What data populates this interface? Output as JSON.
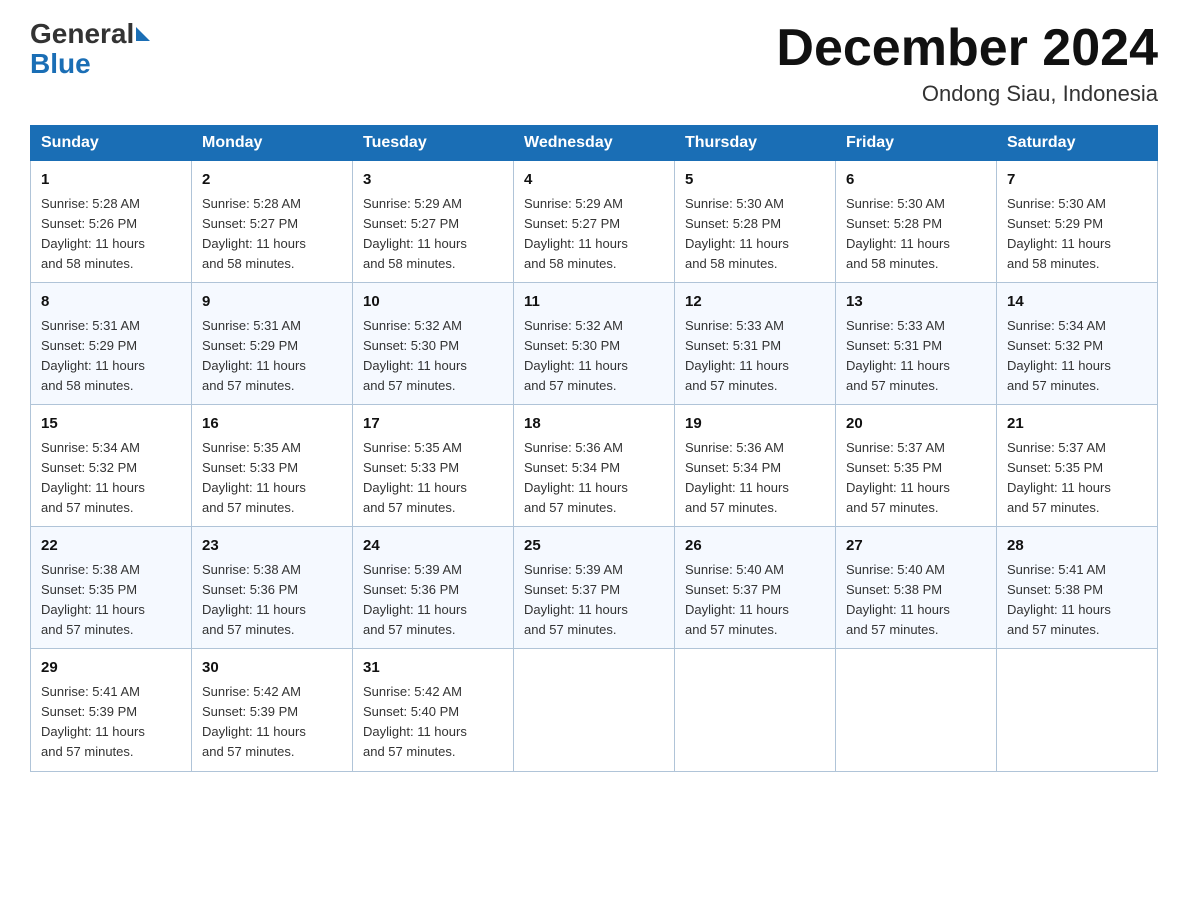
{
  "logo": {
    "general": "General",
    "blue": "Blue"
  },
  "title": "December 2024",
  "location": "Ondong Siau, Indonesia",
  "days_of_week": [
    "Sunday",
    "Monday",
    "Tuesday",
    "Wednesday",
    "Thursday",
    "Friday",
    "Saturday"
  ],
  "weeks": [
    [
      {
        "day": "1",
        "sunrise": "5:28 AM",
        "sunset": "5:26 PM",
        "daylight": "11 hours and 58 minutes."
      },
      {
        "day": "2",
        "sunrise": "5:28 AM",
        "sunset": "5:27 PM",
        "daylight": "11 hours and 58 minutes."
      },
      {
        "day": "3",
        "sunrise": "5:29 AM",
        "sunset": "5:27 PM",
        "daylight": "11 hours and 58 minutes."
      },
      {
        "day": "4",
        "sunrise": "5:29 AM",
        "sunset": "5:27 PM",
        "daylight": "11 hours and 58 minutes."
      },
      {
        "day": "5",
        "sunrise": "5:30 AM",
        "sunset": "5:28 PM",
        "daylight": "11 hours and 58 minutes."
      },
      {
        "day": "6",
        "sunrise": "5:30 AM",
        "sunset": "5:28 PM",
        "daylight": "11 hours and 58 minutes."
      },
      {
        "day": "7",
        "sunrise": "5:30 AM",
        "sunset": "5:29 PM",
        "daylight": "11 hours and 58 minutes."
      }
    ],
    [
      {
        "day": "8",
        "sunrise": "5:31 AM",
        "sunset": "5:29 PM",
        "daylight": "11 hours and 58 minutes."
      },
      {
        "day": "9",
        "sunrise": "5:31 AM",
        "sunset": "5:29 PM",
        "daylight": "11 hours and 57 minutes."
      },
      {
        "day": "10",
        "sunrise": "5:32 AM",
        "sunset": "5:30 PM",
        "daylight": "11 hours and 57 minutes."
      },
      {
        "day": "11",
        "sunrise": "5:32 AM",
        "sunset": "5:30 PM",
        "daylight": "11 hours and 57 minutes."
      },
      {
        "day": "12",
        "sunrise": "5:33 AM",
        "sunset": "5:31 PM",
        "daylight": "11 hours and 57 minutes."
      },
      {
        "day": "13",
        "sunrise": "5:33 AM",
        "sunset": "5:31 PM",
        "daylight": "11 hours and 57 minutes."
      },
      {
        "day": "14",
        "sunrise": "5:34 AM",
        "sunset": "5:32 PM",
        "daylight": "11 hours and 57 minutes."
      }
    ],
    [
      {
        "day": "15",
        "sunrise": "5:34 AM",
        "sunset": "5:32 PM",
        "daylight": "11 hours and 57 minutes."
      },
      {
        "day": "16",
        "sunrise": "5:35 AM",
        "sunset": "5:33 PM",
        "daylight": "11 hours and 57 minutes."
      },
      {
        "day": "17",
        "sunrise": "5:35 AM",
        "sunset": "5:33 PM",
        "daylight": "11 hours and 57 minutes."
      },
      {
        "day": "18",
        "sunrise": "5:36 AM",
        "sunset": "5:34 PM",
        "daylight": "11 hours and 57 minutes."
      },
      {
        "day": "19",
        "sunrise": "5:36 AM",
        "sunset": "5:34 PM",
        "daylight": "11 hours and 57 minutes."
      },
      {
        "day": "20",
        "sunrise": "5:37 AM",
        "sunset": "5:35 PM",
        "daylight": "11 hours and 57 minutes."
      },
      {
        "day": "21",
        "sunrise": "5:37 AM",
        "sunset": "5:35 PM",
        "daylight": "11 hours and 57 minutes."
      }
    ],
    [
      {
        "day": "22",
        "sunrise": "5:38 AM",
        "sunset": "5:35 PM",
        "daylight": "11 hours and 57 minutes."
      },
      {
        "day": "23",
        "sunrise": "5:38 AM",
        "sunset": "5:36 PM",
        "daylight": "11 hours and 57 minutes."
      },
      {
        "day": "24",
        "sunrise": "5:39 AM",
        "sunset": "5:36 PM",
        "daylight": "11 hours and 57 minutes."
      },
      {
        "day": "25",
        "sunrise": "5:39 AM",
        "sunset": "5:37 PM",
        "daylight": "11 hours and 57 minutes."
      },
      {
        "day": "26",
        "sunrise": "5:40 AM",
        "sunset": "5:37 PM",
        "daylight": "11 hours and 57 minutes."
      },
      {
        "day": "27",
        "sunrise": "5:40 AM",
        "sunset": "5:38 PM",
        "daylight": "11 hours and 57 minutes."
      },
      {
        "day": "28",
        "sunrise": "5:41 AM",
        "sunset": "5:38 PM",
        "daylight": "11 hours and 57 minutes."
      }
    ],
    [
      {
        "day": "29",
        "sunrise": "5:41 AM",
        "sunset": "5:39 PM",
        "daylight": "11 hours and 57 minutes."
      },
      {
        "day": "30",
        "sunrise": "5:42 AM",
        "sunset": "5:39 PM",
        "daylight": "11 hours and 57 minutes."
      },
      {
        "day": "31",
        "sunrise": "5:42 AM",
        "sunset": "5:40 PM",
        "daylight": "11 hours and 57 minutes."
      },
      null,
      null,
      null,
      null
    ]
  ],
  "labels": {
    "sunrise": "Sunrise:",
    "sunset": "Sunset:",
    "daylight": "Daylight:"
  }
}
